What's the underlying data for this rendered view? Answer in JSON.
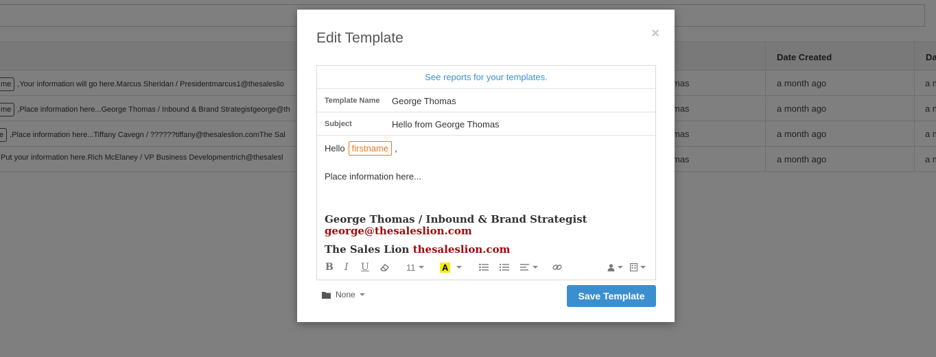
{
  "background": {
    "columns": [
      "Date Created",
      "Da"
    ],
    "rows": [
      {
        "tag": "me",
        "preview": ",Your information will go here.Marcus Sheridan / Presidentmarcus1@thesaleslio",
        "owner": "mas",
        "date": "a month ago",
        "extra": "a m"
      },
      {
        "tag": "me",
        "preview": ",Place information here...George Thomas / Inbound & Brand Strategistgeorge@th",
        "owner": "mas",
        "date": "a month ago",
        "extra": "a m"
      },
      {
        "tag": "e",
        "preview": ",Place information here...Tiffany Cavegn / ??????tiffany@thesaleslion.comThe Sal",
        "owner": "mas",
        "date": "a month ago",
        "extra": "a m"
      },
      {
        "tag": "",
        "preview": "Put your information here.Rich McElaney / VP Business Developmentrich@thesalesl",
        "owner": "mas",
        "date": "a month ago",
        "extra": "a m"
      }
    ]
  },
  "modal": {
    "title": "Edit Template",
    "close_glyph": "×",
    "reports_link": "See reports for your templates.",
    "template_name_label": "Template Name",
    "template_name_value": "George Thomas",
    "subject_label": "Subject",
    "subject_value": "Hello from George Thomas",
    "body": {
      "hello": "Hello",
      "token": "firstname",
      "comma": ",",
      "place": "Place information here...",
      "sig_name": "George Thomas / Inbound & Brand Strategist",
      "sig_email": "george@thesaleslion.com",
      "sig_company": "The Sales Lion",
      "sig_site": "thesaleslion.com"
    },
    "toolbar": {
      "bold": "B",
      "italic": "I",
      "underline": "U",
      "font_size": "11",
      "highlight": "A",
      "icons": [
        "bold-icon",
        "italic-icon",
        "underline-icon",
        "eraser-icon",
        "font-size-dropdown",
        "highlight-color-icon",
        "bulleted-list-icon",
        "numbered-list-icon",
        "align-icon",
        "link-icon",
        "person-icon",
        "building-icon"
      ]
    },
    "folder_label": "None",
    "save_button": "Save Template"
  },
  "colors": {
    "accent": "#3b8fcf",
    "token": "#e87722",
    "signature_red": "#9b0d0d"
  }
}
